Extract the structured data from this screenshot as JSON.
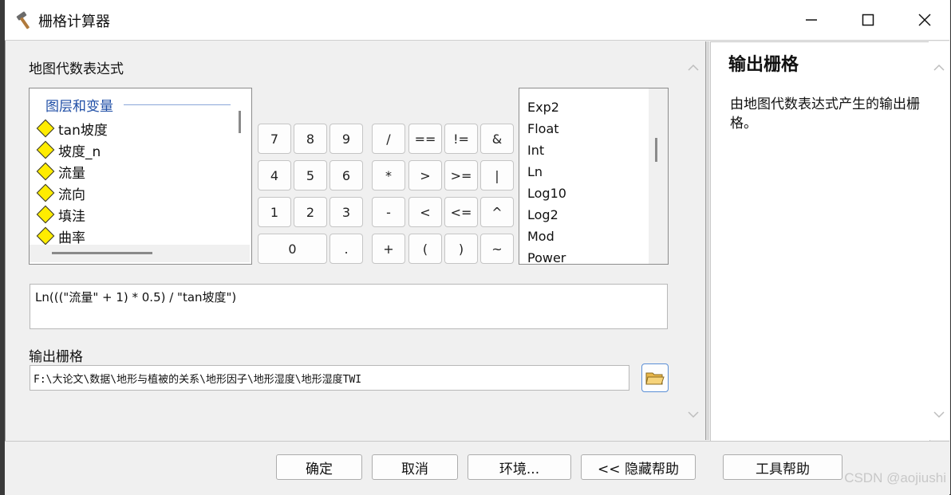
{
  "window": {
    "title": "栅格计算器"
  },
  "expression_section": {
    "label": "地图代数表达式"
  },
  "layers": {
    "header": "图层和变量",
    "items": [
      "tan坡度",
      "坡度_n",
      "流量",
      "流向",
      "填洼",
      "曲率"
    ]
  },
  "keypad": {
    "rows": [
      [
        "7",
        "8",
        "9",
        "/",
        "==",
        "!=",
        "&"
      ],
      [
        "4",
        "5",
        "6",
        "*",
        ">",
        ">=",
        "|"
      ],
      [
        "1",
        "2",
        "3",
        "-",
        "<",
        "<=",
        "^"
      ],
      [
        "0",
        ".",
        "+",
        "(",
        ")",
        "~"
      ]
    ]
  },
  "functions": {
    "items": [
      "Exp2",
      "Float",
      "Int",
      "Ln",
      "Log10",
      "Log2",
      "Mod",
      "Power"
    ]
  },
  "expression": {
    "value": "Ln(((\"流量\" + 1) * 0.5) / \"tan坡度\")"
  },
  "output": {
    "label": "输出栅格",
    "value": "F:\\大论文\\数据\\地形与植被的关系\\地形因子\\地形湿度\\地形湿度TWI"
  },
  "help": {
    "title": "输出栅格",
    "text": "由地图代数表达式产生的输出栅格。"
  },
  "buttons": {
    "ok": "确定",
    "cancel": "取消",
    "environments": "环境...",
    "hide_help": "<< 隐藏帮助",
    "tool_help": "工具帮助"
  },
  "watermark": "CSDN @aojiushi"
}
